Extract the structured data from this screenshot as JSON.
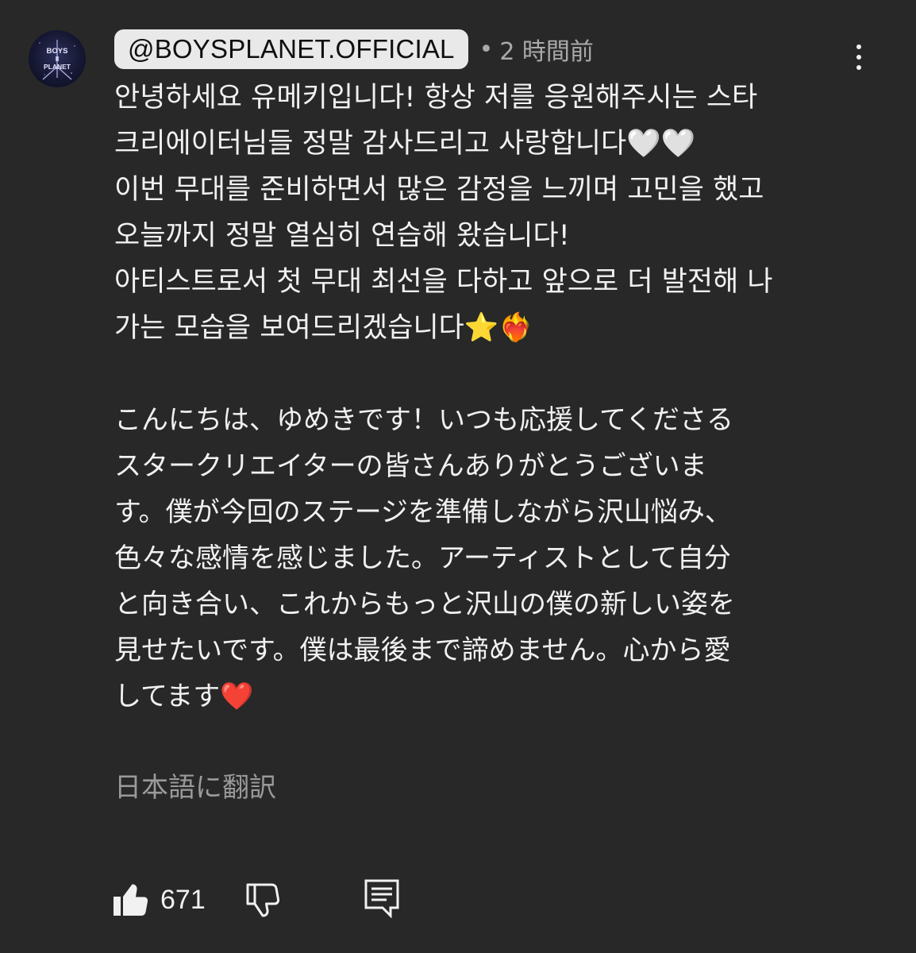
{
  "comment": {
    "channel_handle": "@BOYSPLANET.OFFICIAL",
    "separator": "•",
    "timestamp": "2 時間前",
    "avatar_text": [
      "BOYS",
      "II",
      "PLANET"
    ],
    "korean_lines": [
      "안녕하세요 유메키입니다! 항상 저를 응원해주시는 스타",
      "크리에이터님들 정말 감사드리고 사랑합니다🤍🤍",
      "이번 무대를 준비하면서 많은 감정을 느끼며 고민을 했고",
      "오늘까지 정말 열심히 연습해 왔습니다!",
      "아티스트로서 첫 무대 최선을 다하고 앞으로 더 발전해 나",
      "가는 모습을 보여드리겠습니다⭐️❤️‍🔥"
    ],
    "japanese_lines": [
      "こんにちは、ゆめきです！いつも応援してくださる",
      "スタークリエイターの皆さんありがとうございま",
      "す。僕が今回のステージを準備しながら沢山悩み、",
      "色々な感情を感じました。アーティストとして自分",
      "と向き合い、これからもっと沢山の僕の新しい姿を",
      "見せたいです。僕は最後まで諦めません。心から愛",
      "してます❤️"
    ],
    "translate_label": "日本語に翻訳"
  },
  "actions": {
    "like_count": "671",
    "like_icon": "thumbs-up-icon",
    "dislike_icon": "thumbs-down-icon",
    "reply_icon": "reply-icon"
  },
  "colors": {
    "background": "#282828",
    "text": "#f1f1f1",
    "secondary_text": "#aaaaaa",
    "handle_pill": "#e9e9e9"
  }
}
